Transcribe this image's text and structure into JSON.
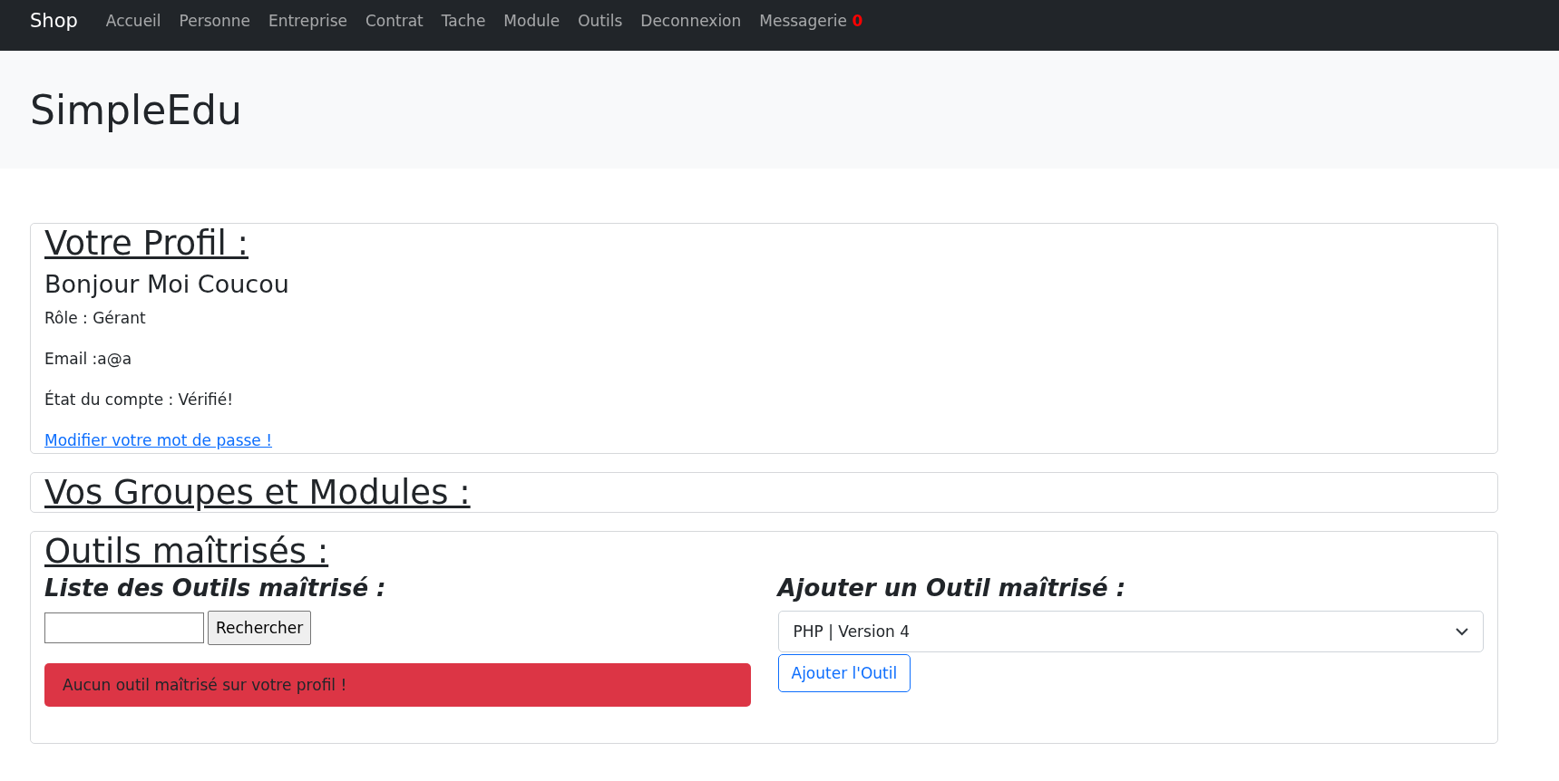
{
  "navbar": {
    "brand": "Shop",
    "items": [
      {
        "label": "Accueil"
      },
      {
        "label": "Personne"
      },
      {
        "label": "Entreprise"
      },
      {
        "label": "Contrat"
      },
      {
        "label": "Tache"
      },
      {
        "label": "Module"
      },
      {
        "label": "Outils"
      },
      {
        "label": "Deconnexion"
      },
      {
        "label": "Messagerie",
        "badge": "0"
      }
    ]
  },
  "header": {
    "title": "SimpleEdu"
  },
  "profile": {
    "heading": "Votre Profil :",
    "greeting": "Bonjour Moi Coucou",
    "lines": [
      "Rôle : Gérant",
      "Email :a@a",
      "État du compte : Vérifié!"
    ],
    "link": "Modifier votre mot de passe !"
  },
  "groups": {
    "heading": "Vos Groupes et Modules :"
  },
  "tools": {
    "heading": "Outils maîtrisés :",
    "list": {
      "heading": "Liste des Outils maîtrisé :",
      "search_button": "Rechercher",
      "alert": "Aucun outil maîtrisé sur votre profil !"
    },
    "add": {
      "heading": "Ajouter un Outil maîtrisé :",
      "select_value": "PHP | Version 4",
      "button": "Ajouter l'Outil"
    }
  }
}
